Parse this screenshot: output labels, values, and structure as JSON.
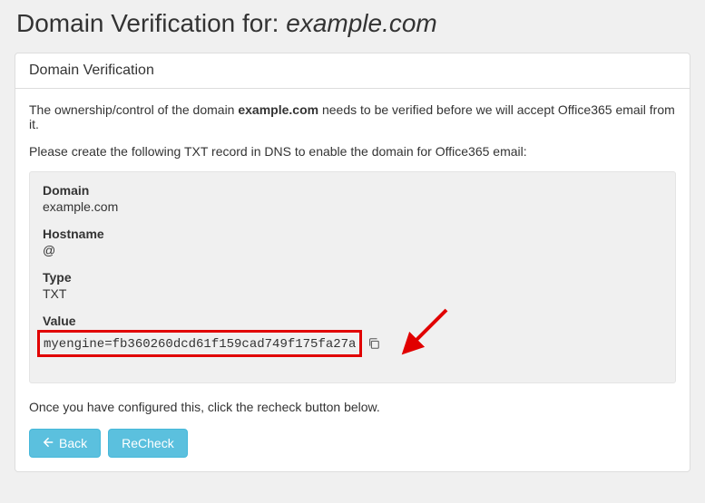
{
  "header": {
    "title_prefix": "Domain Verification for: ",
    "domain": "example.com"
  },
  "panel": {
    "heading": "Domain Verification",
    "intro_prefix": "The ownership/control of the domain ",
    "intro_domain": "example.com",
    "intro_suffix": " needs to be verified before we will accept Office365 email from it.",
    "instructions": "Please create the following TXT record in DNS to enable the domain for Office365 email:",
    "record": {
      "domain_label": "Domain",
      "domain_value": "example.com",
      "hostname_label": "Hostname",
      "hostname_value": "@",
      "type_label": "Type",
      "type_value": "TXT",
      "value_label": "Value",
      "txt_value": "myengine=fb360260dcd61f159cad749f175fa27a"
    },
    "post_instruction": "Once you have configured this, click the recheck button below.",
    "buttons": {
      "back": "Back",
      "recheck": "ReCheck"
    }
  },
  "annotation": {
    "highlight_color": "#e10000"
  }
}
